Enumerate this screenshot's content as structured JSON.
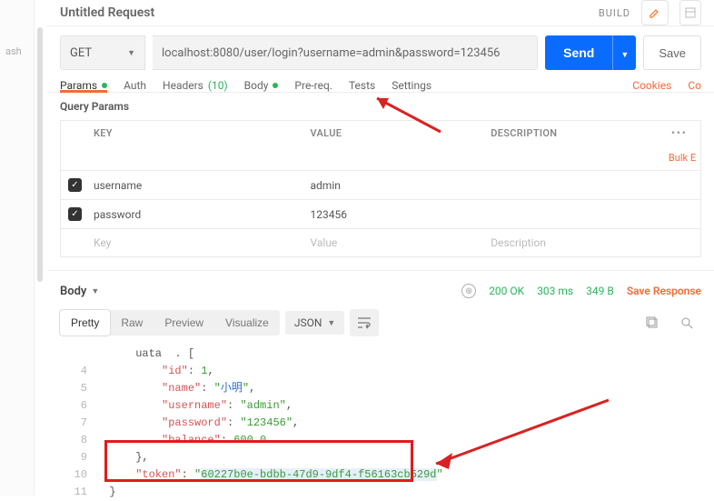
{
  "left_rail_label": "ash",
  "header": {
    "title": "Untitled Request",
    "build": "BUILD"
  },
  "request": {
    "method": "GET",
    "url": "localhost:8080/user/login?username=admin&password=123456",
    "send": "Send",
    "save": "Save"
  },
  "tabs": {
    "params": "Params",
    "auth": "Auth",
    "headers": "Headers",
    "headers_count": "(10)",
    "body": "Body",
    "prereq": "Pre-req.",
    "tests": "Tests",
    "settings": "Settings",
    "cookies": "Cookies",
    "code_link": "Co"
  },
  "query": {
    "title": "Query Params",
    "cols": {
      "key": "KEY",
      "value": "VALUE",
      "desc": "DESCRIPTION"
    },
    "rows": [
      {
        "key": "username",
        "value": "admin",
        "desc": ""
      },
      {
        "key": "password",
        "value": "123456",
        "desc": ""
      }
    ],
    "placeholders": {
      "key": "Key",
      "value": "Value",
      "desc": "Description"
    },
    "bulk": "Bulk E"
  },
  "response": {
    "body_label": "Body",
    "status_code": "200 OK",
    "time": "303 ms",
    "size": "349 B",
    "save": "Save Response"
  },
  "viewer": {
    "pretty": "Pretty",
    "raw": "Raw",
    "preview": "Preview",
    "visualize": "Visualize",
    "format": "JSON"
  },
  "code_lines": [
    {
      "n": "",
      "html": "      uata  . ["
    },
    {
      "n": "4",
      "html": "          <span class='key'>\"id\"</span>: <span class='num'>1</span>,"
    },
    {
      "n": "5",
      "html": "          <span class='key'>\"name\"</span>: <span class='str'>\"</span><span class='blue'>小明</span><span class='str'>\"</span>,"
    },
    {
      "n": "6",
      "html": "          <span class='key'>\"username\"</span>: <span class='str'>\"admin\"</span>,"
    },
    {
      "n": "7",
      "html": "          <span class='key'>\"password\"</span>: <span class='str'>\"123456\"</span>,"
    },
    {
      "n": "8",
      "html": "          <span class='key'>\"balance\"</span>: <span class='num'>600.0</span>"
    },
    {
      "n": "9",
      "html": "      },"
    },
    {
      "n": "10",
      "html": "      <span class='key'>\"token\"</span>: <span class='str'>\"<span class='hl'>60227b0e-bdbb-47d9-9df4-f56163cb529d</span>\"</span>"
    },
    {
      "n": "11",
      "html": "  }"
    }
  ]
}
